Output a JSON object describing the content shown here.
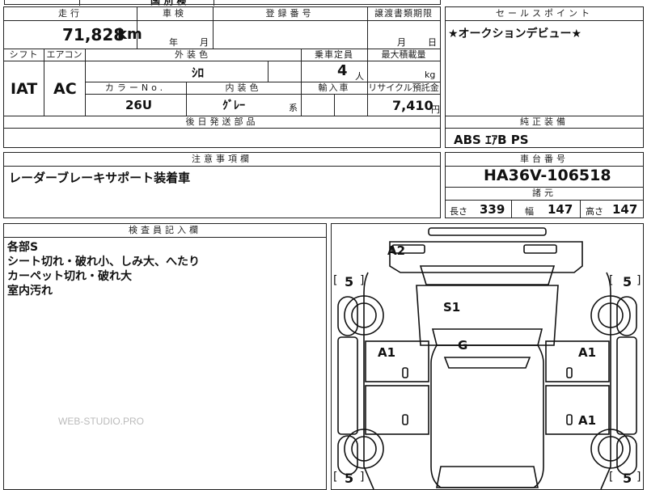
{
  "top_strip": {
    "partial": "国 別 検"
  },
  "mileage": {
    "header": "走行",
    "value": "71,828",
    "unit": "km"
  },
  "inspection": {
    "header": "車検",
    "year_label": "年",
    "month_label": "月"
  },
  "registration": {
    "header": "登録番号"
  },
  "transfer_deadline": {
    "header": "譲渡書類期限",
    "month_label": "月",
    "day_label": "日"
  },
  "sales_point": {
    "header": "セールスポイント",
    "text": "★オークションデビュー★"
  },
  "shift": {
    "header": "シフト",
    "value": "IAT"
  },
  "aircon": {
    "header": "エアコン",
    "value": "AC"
  },
  "exterior_color": {
    "header": "外装色",
    "value": "ｼﾛ"
  },
  "capacity": {
    "header": "乗車定員",
    "value": "4",
    "unit": "人"
  },
  "max_load": {
    "header": "最大積載量",
    "unit": "kg"
  },
  "color_no": {
    "header": "カラーNo.",
    "value": "26U"
  },
  "interior_color": {
    "header": "内装色",
    "value": "ｸﾞﾚｰ",
    "suffix": "系"
  },
  "import": {
    "header": "輸入車"
  },
  "recycle": {
    "header": "リサイクル預託金",
    "value": "7,410",
    "unit": "円"
  },
  "later_parts": {
    "header": "後日発送部品"
  },
  "genuine_equipment": {
    "header": "純正装備",
    "text": "ABS ｴｱB PS"
  },
  "notes": {
    "header": "注意事項欄",
    "text": "レーダーブレーキサポート装着車"
  },
  "chassis": {
    "header": "車台番号",
    "value": "HA36V-106518"
  },
  "specs": {
    "header": "諸元",
    "length_label": "長さ",
    "length": "339",
    "width_label": "幅",
    "width": "147",
    "height_label": "高さ",
    "height": "147"
  },
  "inspector": {
    "header": "検査員記入欄",
    "lines": [
      "各部S",
      "シート切れ・破れ小、しみ大、へたり",
      "カーペット切れ・破れ大",
      "室内汚れ"
    ]
  },
  "diagram": {
    "bracket_left": "[",
    "bracket_right": "]",
    "tire_fl": "5",
    "tire_fr": "5",
    "tire_rl": "5",
    "tire_rr": "5",
    "mark_a2": "A2",
    "mark_s1": "S1",
    "mark_g": "G",
    "mark_a1_left": "A1",
    "mark_a1_right": "A1",
    "mark_a1_right_rear": "A1",
    "door_mark": "0"
  },
  "watermark": "WEB-STUDIO.PRO"
}
